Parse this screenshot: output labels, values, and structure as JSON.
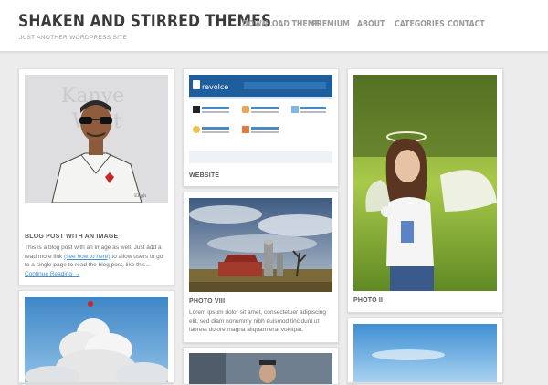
{
  "site": {
    "title": "SHAKEN AND STIRRED THEMES",
    "tagline": "JUST ANOTHER WORDPRESS SITE"
  },
  "nav": {
    "items": [
      "DOWNLOAD THEME",
      "PREMIUM",
      "ABOUT",
      "CATEGORIES",
      "CONTACT"
    ]
  },
  "posts": {
    "blog": {
      "title": "BLOG POST WITH AN IMAGE",
      "excerpt_before": "This is a blog post with an image as well. Just add a read more link ",
      "excerpt_link": "(see how to here)",
      "excerpt_after": " to allow users to go to a single page to read the blog post, like this...",
      "more_link": "Continue Reading →",
      "image_text": "Kanye West"
    },
    "website": {
      "title": "WEBSITE"
    },
    "photo8": {
      "title": "PHOTO VIII",
      "excerpt": "Lorem ipsum dolor sit amet, consectetuer adipiscing elit, sed diam nonummy nibh euismod tincidunt ut laoreet dolore magna aliquam erat volutpat."
    },
    "photo2": {
      "title": "PHOTO II"
    }
  },
  "colors": {
    "link": "#3f8fd0",
    "title_text": "#3a3a3a",
    "nav_text": "#9b9b9b",
    "background": "#ececec"
  }
}
